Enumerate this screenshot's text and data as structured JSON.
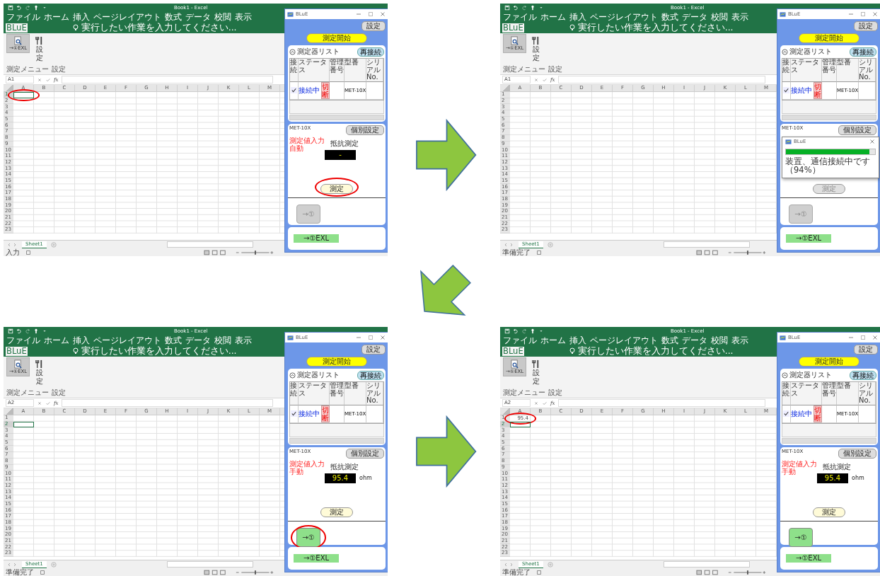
{
  "panels": [
    {
      "excel": {
        "title": "Book1 - Excel",
        "menu_tabs": [
          {
            "label": "ファイル",
            "selected": false
          },
          {
            "label": "ホーム",
            "selected": false
          },
          {
            "label": "挿入",
            "selected": false
          },
          {
            "label": "ページレイアウト",
            "selected": false
          },
          {
            "label": "数式",
            "selected": false
          },
          {
            "label": "データ",
            "selected": false
          },
          {
            "label": "校閲",
            "selected": false
          },
          {
            "label": "表示",
            "selected": false
          },
          {
            "label": "BLuE",
            "selected": true
          }
        ],
        "tell_me": "実行したい作業を入力してください...",
        "ribbon_buttons": [
          {
            "label": "→①EXL",
            "kind": "measure",
            "selected": true
          },
          {
            "label": "設定",
            "kind": "settings",
            "selected": false
          }
        ],
        "ribbon_groups": [
          "測定メニュー",
          "設定"
        ],
        "name_box": "A1",
        "fx": "fx",
        "columns": [
          "A",
          "B",
          "C",
          "D",
          "E",
          "F",
          "G",
          "H",
          "I",
          "J",
          "K",
          "L",
          "M"
        ],
        "rows": [
          "1",
          "2",
          "3",
          "4",
          "5",
          "6",
          "7",
          "8",
          "9",
          "10",
          "11",
          "12",
          "13",
          "14",
          "15",
          "16",
          "17",
          "18",
          "19",
          "20",
          "21",
          "22",
          "23"
        ],
        "a_cells": [
          {
            "selected": true,
            "circled": true
          },
          {
            "selected": false,
            "circled": false
          }
        ],
        "sheet_tab": "Sheet1",
        "status": "入力"
      },
      "tool": {
        "title": "BLuE",
        "settings_button": "設定",
        "start_button": "測定開始",
        "list_title": "測定器リスト",
        "reconnect_button": "再接続",
        "headers": [
          "接続",
          "ステータス",
          "管理番号",
          "型番",
          "シリアルNo."
        ],
        "devices": [
          {
            "checked": true,
            "status": "接続中",
            "disconnect": "切断",
            "model": "MET-10X"
          }
        ],
        "device_name": "MET-10X",
        "individual_button": "個別設定",
        "mode": [
          "測定値入力",
          "自動"
        ],
        "measure_title": "抵抗測定",
        "reading": "-",
        "measure_button": {
          "label": "測定",
          "disabled": false,
          "circled": true
        },
        "send_button": {
          "label": "→①",
          "disabled": true,
          "circled": false
        },
        "exl_button": "→①EXL"
      }
    },
    {
      "excel": {
        "title": "Book1 - Excel",
        "menu_tabs": [
          {
            "label": "ファイル",
            "selected": false
          },
          {
            "label": "ホーム",
            "selected": false
          },
          {
            "label": "挿入",
            "selected": false
          },
          {
            "label": "ページレイアウト",
            "selected": false
          },
          {
            "label": "数式",
            "selected": false
          },
          {
            "label": "データ",
            "selected": false
          },
          {
            "label": "校閲",
            "selected": false
          },
          {
            "label": "表示",
            "selected": false
          },
          {
            "label": "BLuE",
            "selected": true
          }
        ],
        "tell_me": "実行したい作業を入力してください...",
        "ribbon_buttons": [
          {
            "label": "→①EXL",
            "kind": "measure",
            "selected": true
          },
          {
            "label": "設定",
            "kind": "settings",
            "selected": false
          }
        ],
        "ribbon_groups": [
          "測定メニュー",
          "設定"
        ],
        "name_box": "A1",
        "fx": "fx",
        "columns": [
          "A",
          "B",
          "C",
          "D",
          "E",
          "F",
          "G",
          "H",
          "I",
          "J",
          "K",
          "L",
          "M"
        ],
        "rows": [
          "1",
          "2",
          "3",
          "4",
          "5",
          "6",
          "7",
          "8",
          "9",
          "10",
          "11",
          "12",
          "13",
          "14",
          "15",
          "16",
          "17",
          "18",
          "19",
          "20",
          "21",
          "22",
          "23"
        ],
        "a_cells": [
          {
            "selected": false,
            "circled": false
          },
          {
            "selected": false,
            "circled": false
          }
        ],
        "sheet_tab": "Sheet1",
        "status": "準備完了"
      },
      "tool": {
        "title": "BLuE",
        "settings_button": "設定",
        "start_button": "測定開始",
        "list_title": "測定器リスト",
        "reconnect_button": "再接続",
        "headers": [
          "接続",
          "ステータス",
          "管理番号",
          "型番",
          "シリアルNo."
        ],
        "devices": [
          {
            "checked": true,
            "status": "接続中",
            "disconnect": "切断",
            "model": "MET-10X"
          }
        ],
        "device_name": "MET-10X",
        "individual_button": "個別設定",
        "measure_button": {
          "label": "測定",
          "disabled": true,
          "circled": false
        },
        "send_button": {
          "label": "→①",
          "disabled": true,
          "circled": false
        },
        "exl_button": "→①EXL",
        "progress": {
          "title": "BLuE",
          "level": 0.94,
          "message": "装置、通信接続中です（94%）"
        }
      }
    },
    {
      "excel": {
        "title": "Book1 - Excel",
        "menu_tabs": [
          {
            "label": "ファイル",
            "selected": false
          },
          {
            "label": "ホーム",
            "selected": false
          },
          {
            "label": "挿入",
            "selected": false
          },
          {
            "label": "ページレイアウト",
            "selected": false
          },
          {
            "label": "数式",
            "selected": false
          },
          {
            "label": "データ",
            "selected": false
          },
          {
            "label": "校閲",
            "selected": false
          },
          {
            "label": "表示",
            "selected": false
          },
          {
            "label": "BLuE",
            "selected": true
          }
        ],
        "tell_me": "実行したい作業を入力してください...",
        "ribbon_buttons": [
          {
            "label": "→①EXL",
            "kind": "measure",
            "selected": true
          },
          {
            "label": "設定",
            "kind": "settings",
            "selected": false
          }
        ],
        "ribbon_groups": [
          "測定メニュー",
          "設定"
        ],
        "name_box": "A2",
        "fx": "fx",
        "columns": [
          "A",
          "B",
          "C",
          "D",
          "E",
          "F",
          "G",
          "H",
          "I",
          "J",
          "K",
          "L",
          "M"
        ],
        "rows": [
          "1",
          "2",
          "3",
          "4",
          "5",
          "6",
          "7",
          "8",
          "9",
          "10",
          "11",
          "12",
          "13",
          "14",
          "15",
          "16",
          "17",
          "18",
          "19",
          "20",
          "21",
          "22",
          "23"
        ],
        "a_cells": [
          {
            "selected": false,
            "circled": false
          },
          {
            "selected": true,
            "circled": false
          }
        ],
        "sheet_tab": "Sheet1",
        "status": "準備完了"
      },
      "tool": {
        "title": "BLuE",
        "settings_button": "設定",
        "start_button": "測定開始",
        "list_title": "測定器リスト",
        "reconnect_button": "再接続",
        "headers": [
          "接続",
          "ステータス",
          "管理番号",
          "型番",
          "シリアルNo."
        ],
        "devices": [
          {
            "checked": true,
            "status": "接続中",
            "disconnect": "切断",
            "model": "MET-10X"
          }
        ],
        "device_name": "MET-10X",
        "individual_button": "個別設定",
        "mode": [
          "測定値入力",
          "手動"
        ],
        "measure_title": "抵抗測定",
        "reading": "95.4",
        "unit": "ohm",
        "measure_button": {
          "label": "測定",
          "disabled": false,
          "circled": false
        },
        "send_button": {
          "label": "→①",
          "disabled": false,
          "circled": true
        },
        "exl_button": "→①EXL"
      }
    },
    {
      "excel": {
        "title": "Book1 - Excel",
        "menu_tabs": [
          {
            "label": "ファイル",
            "selected": false
          },
          {
            "label": "ホーム",
            "selected": false
          },
          {
            "label": "挿入",
            "selected": false
          },
          {
            "label": "ページレイアウト",
            "selected": false
          },
          {
            "label": "数式",
            "selected": false
          },
          {
            "label": "データ",
            "selected": false
          },
          {
            "label": "校閲",
            "selected": false
          },
          {
            "label": "表示",
            "selected": false
          },
          {
            "label": "BLuE",
            "selected": true
          }
        ],
        "tell_me": "実行したい作業を入力してください...",
        "ribbon_buttons": [
          {
            "label": "→①EXL",
            "kind": "measure",
            "selected": true
          },
          {
            "label": "設定",
            "kind": "settings",
            "selected": false
          }
        ],
        "ribbon_groups": [
          "測定メニュー",
          "設定"
        ],
        "name_box": "A2",
        "fx": "fx",
        "columns": [
          "A",
          "B",
          "C",
          "D",
          "E",
          "F",
          "G",
          "H",
          "I",
          "J",
          "K",
          "L",
          "M"
        ],
        "rows": [
          "1",
          "2",
          "3",
          "4",
          "5",
          "6",
          "7",
          "8",
          "9",
          "10",
          "11",
          "12",
          "13",
          "14",
          "15",
          "16",
          "17",
          "18",
          "19",
          "20",
          "21",
          "22",
          "23"
        ],
        "a_cells": [
          {
            "selected": false,
            "circled": true,
            "value": "95.4"
          },
          {
            "selected": true,
            "circled": false
          }
        ],
        "sheet_tab": "Sheet1",
        "status": "準備完了"
      },
      "tool": {
        "title": "BLuE",
        "settings_button": "設定",
        "start_button": "測定開始",
        "list_title": "測定器リスト",
        "reconnect_button": "再接続",
        "headers": [
          "接続",
          "ステータス",
          "管理番号",
          "型番",
          "シリアルNo."
        ],
        "devices": [
          {
            "checked": true,
            "status": "接続中",
            "disconnect": "切断",
            "model": "MET-10X"
          }
        ],
        "device_name": "MET-10X",
        "individual_button": "個別設定",
        "mode": [
          "測定値入力",
          "手動"
        ],
        "measure_title": "抵抗測定",
        "reading": "95.4",
        "unit": "ohm",
        "measure_button": {
          "label": "測定",
          "disabled": false,
          "circled": false
        },
        "send_button": {
          "label": "→①",
          "disabled": false,
          "circled": false
        },
        "exl_button": "→①EXL"
      }
    }
  ],
  "arrows": [
    {
      "kind": "rightward"
    },
    {
      "kind": "diagonal"
    },
    {
      "kind": "rightward"
    }
  ]
}
